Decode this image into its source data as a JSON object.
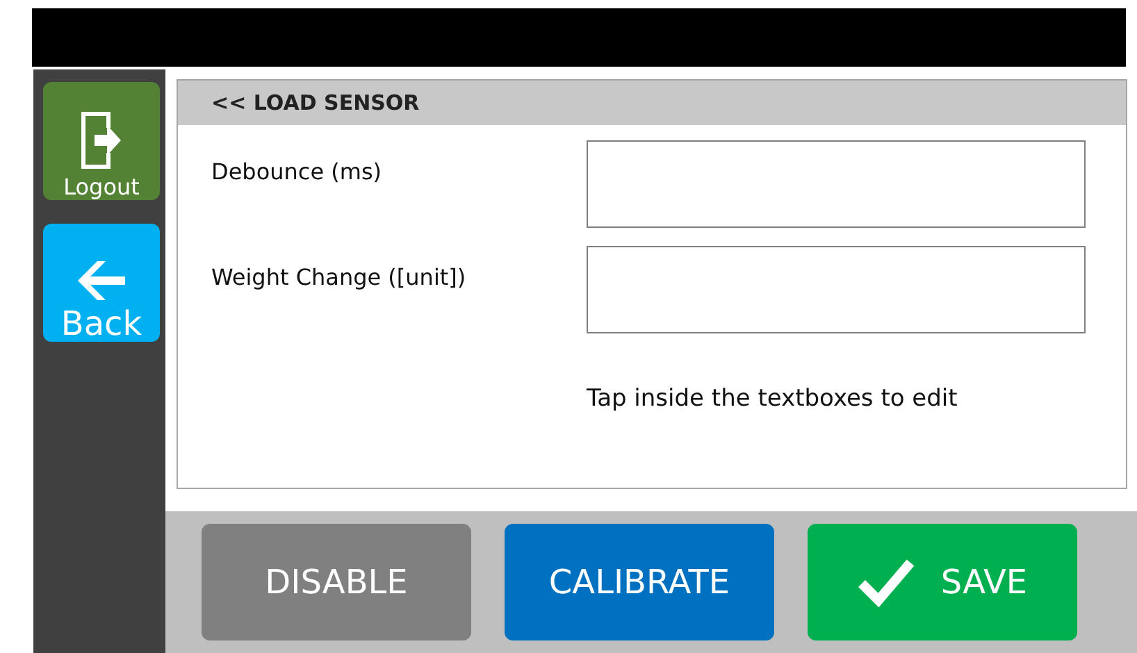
{
  "sidebar": {
    "buttons": [
      {
        "label": "Logout",
        "kind": "logout"
      },
      {
        "label": "Back",
        "kind": "back"
      }
    ]
  },
  "panel": {
    "title": "<< LOAD SENSOR",
    "fields": [
      {
        "label": "Debounce (ms)"
      },
      {
        "label": "Weight Change ([unit])"
      }
    ],
    "hint": "Tap inside the textboxes to edit"
  },
  "actions": [
    {
      "label": "DISABLE",
      "kind": "disable"
    },
    {
      "label": "CALIBRATE",
      "kind": "calibrate"
    },
    {
      "label": "SAVE",
      "kind": "save"
    }
  ]
}
